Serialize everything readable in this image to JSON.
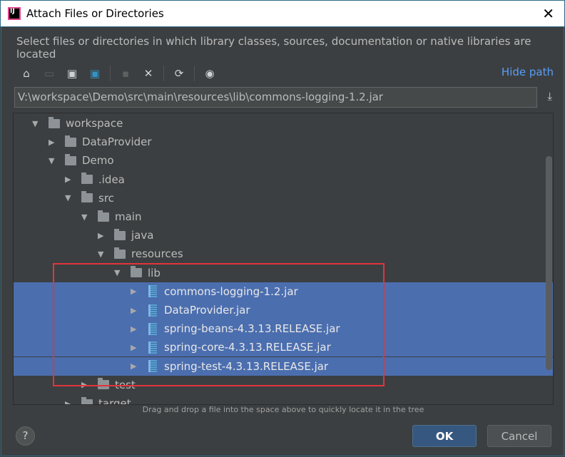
{
  "window": {
    "title": "Attach Files or Directories"
  },
  "description": "Select files or directories in which library classes, sources, documentation or native libraries are located",
  "toolbar": {
    "icons": [
      "home-icon",
      "desktop-icon",
      "project-folder-icon",
      "module-folder-icon",
      "new-folder-icon",
      "delete-icon",
      "refresh-icon",
      "show-hidden-icon"
    ],
    "hide_path": "Hide path"
  },
  "path": "V:\\workspace\\Demo\\src\\main\\resources\\lib\\commons-logging-1.2.jar",
  "tree": [
    {
      "label": "workspace",
      "level": 0,
      "expanded": true,
      "type": "folder"
    },
    {
      "label": "DataProvider",
      "level": 1,
      "expanded": false,
      "type": "folder"
    },
    {
      "label": "Demo",
      "level": 1,
      "expanded": true,
      "type": "folder"
    },
    {
      "label": ".idea",
      "level": 2,
      "expanded": false,
      "type": "folder"
    },
    {
      "label": "src",
      "level": 2,
      "expanded": true,
      "type": "folder"
    },
    {
      "label": "main",
      "level": 3,
      "expanded": true,
      "type": "folder"
    },
    {
      "label": "java",
      "level": 4,
      "expanded": false,
      "type": "folder"
    },
    {
      "label": "resources",
      "level": 4,
      "expanded": true,
      "type": "folder"
    },
    {
      "label": "lib",
      "level": 5,
      "expanded": true,
      "type": "folder"
    },
    {
      "label": "commons-logging-1.2.jar",
      "level": 6,
      "expanded": false,
      "type": "jar",
      "selected": true
    },
    {
      "label": "DataProvider.jar",
      "level": 6,
      "expanded": false,
      "type": "jar",
      "selected": true
    },
    {
      "label": "spring-beans-4.3.13.RELEASE.jar",
      "level": 6,
      "expanded": false,
      "type": "jar",
      "selected": true
    },
    {
      "label": "spring-core-4.3.13.RELEASE.jar",
      "level": 6,
      "expanded": false,
      "type": "jar",
      "selected": true
    },
    {
      "label": "spring-test-4.3.13.RELEASE.jar",
      "level": 6,
      "expanded": false,
      "type": "jar",
      "selected": true
    },
    {
      "label": "test",
      "level": 3,
      "expanded": false,
      "type": "folder"
    },
    {
      "label": "target",
      "level": 2,
      "expanded": false,
      "type": "folder"
    }
  ],
  "hint": "Drag and drop a file into the space above to quickly locate it in the tree",
  "buttons": {
    "help": "?",
    "ok": "OK",
    "cancel": "Cancel"
  },
  "colors": {
    "selection": "#4b6eaf",
    "accent": "#589df6",
    "highlight_box": "#e0353b"
  }
}
